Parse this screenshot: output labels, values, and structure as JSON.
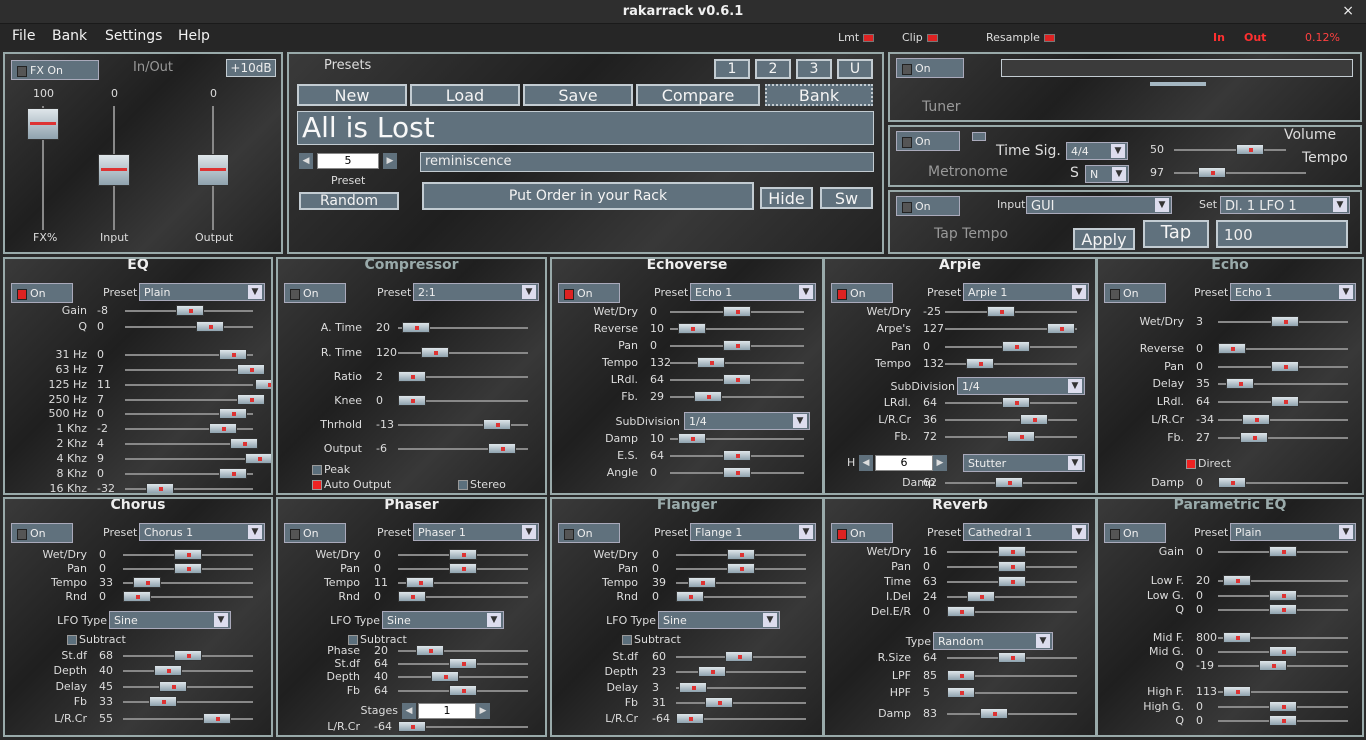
{
  "title": "rakarrack   v0.6.1",
  "close": "×",
  "menu": [
    "File",
    "Bank",
    "Settings",
    "Help"
  ],
  "indicators": {
    "lmt": "Lmt",
    "clip": "Clip",
    "resample": "Resample",
    "in": "In",
    "out": "Out",
    "cpu": "0.12%"
  },
  "io": {
    "fx_on": "FX On",
    "title": "In/Out",
    "gain_btn": "+10dB",
    "fx": {
      "label": "FX%",
      "value": "100"
    },
    "input": {
      "label": "Input",
      "value": "0"
    },
    "output": {
      "label": "Output",
      "value": "0"
    }
  },
  "presets": {
    "title": "Presets",
    "n1": "1",
    "n2": "2",
    "n3": "3",
    "u": "U",
    "new": "New",
    "load": "Load",
    "save": "Save",
    "compare": "Compare",
    "bank": "Bank",
    "name": "All is Lost",
    "number": "5",
    "number_label": "Preset",
    "author": "reminiscence",
    "random": "Random",
    "order": "Put Order in your Rack",
    "hide": "Hide",
    "sw": "Sw"
  },
  "tuner": {
    "on": "On",
    "label": "Tuner"
  },
  "metronome": {
    "on": "On",
    "label": "Metronome",
    "timesig_label": "Time Sig.",
    "timesig": "4/4",
    "s_label": "S",
    "s": "N",
    "volume_label": "Volume",
    "volume": "50",
    "tempo_label": "Tempo",
    "tempo": "97"
  },
  "tap": {
    "on": "On",
    "label": "Tap Tempo",
    "input_label": "Input",
    "input": "GUI",
    "set_label": "Set",
    "set": "Dl. 1 LFO 1",
    "apply": "Apply",
    "tap": "Tap",
    "value": "100"
  },
  "eq": {
    "title": "EQ",
    "on": "On",
    "preset_label": "Preset",
    "preset": "Plain",
    "rows": [
      [
        "Gain",
        "-8"
      ],
      [
        "Q",
        "0"
      ],
      [
        "31 Hz",
        "0"
      ],
      [
        "63 Hz",
        "7"
      ],
      [
        "125 Hz",
        "11"
      ],
      [
        "250 Hz",
        "7"
      ],
      [
        "500 Hz",
        "0"
      ],
      [
        "1 Khz",
        "-2"
      ],
      [
        "2 Khz",
        "4"
      ],
      [
        "4 Khz",
        "9"
      ],
      [
        "8 Khz",
        "0"
      ],
      [
        "16 Khz",
        "-32"
      ]
    ]
  },
  "compressor": {
    "title": "Compressor",
    "on": "On",
    "preset_label": "Preset",
    "preset": "2:1",
    "rows": [
      [
        "A. Time",
        "20"
      ],
      [
        "R. Time",
        "120"
      ],
      [
        "Ratio",
        "2"
      ],
      [
        "Knee",
        "0"
      ],
      [
        "Thrhold",
        "-13"
      ],
      [
        "Output",
        "-6"
      ]
    ],
    "peak": "Peak",
    "auto": "Auto Output",
    "stereo": "Stereo"
  },
  "echoverse": {
    "title": "Echoverse",
    "on": "On",
    "preset_label": "Preset",
    "preset": "Echo 1",
    "rows": [
      [
        "Wet/Dry",
        "0"
      ],
      [
        "Reverse",
        "10"
      ],
      [
        "Pan",
        "0"
      ],
      [
        "Tempo",
        "132"
      ],
      [
        "LRdl.",
        "64"
      ],
      [
        "Fb.",
        "29"
      ]
    ],
    "subdiv_label": "SubDivision",
    "subdiv": "1/4",
    "rows2": [
      [
        "Damp",
        "10"
      ],
      [
        "E.S.",
        "64"
      ],
      [
        "Angle",
        "0"
      ]
    ]
  },
  "arpie": {
    "title": "Arpie",
    "on": "On",
    "preset_label": "Preset",
    "preset": "Arpie 1",
    "rows": [
      [
        "Wet/Dry",
        "-25"
      ],
      [
        "Arpe's",
        "127"
      ],
      [
        "Pan",
        "0"
      ],
      [
        "Tempo",
        "132"
      ]
    ],
    "subdiv_label": "SubDivision",
    "subdiv": "1/4",
    "rows2": [
      [
        "LRdl.",
        "64"
      ],
      [
        "L/R.Cr",
        "36"
      ],
      [
        "Fb.",
        "72"
      ]
    ],
    "h_label": "H",
    "h": "6",
    "mode": "Stutter",
    "damp_label": "Damp",
    "damp": "62"
  },
  "echo": {
    "title": "Echo",
    "on": "On",
    "preset_label": "Preset",
    "preset": "Echo 1",
    "rows": [
      [
        "Wet/Dry",
        "3"
      ],
      [
        "Reverse",
        "0"
      ],
      [
        "Pan",
        "0"
      ],
      [
        "Delay",
        "35"
      ],
      [
        "LRdl.",
        "64"
      ],
      [
        "L/R.Cr",
        "-34"
      ],
      [
        "Fb.",
        "27"
      ]
    ],
    "direct": "Direct",
    "damp_label": "Damp",
    "damp": "0"
  },
  "chorus": {
    "title": "Chorus",
    "on": "On",
    "preset_label": "Preset",
    "preset": "Chorus 1",
    "rows": [
      [
        "Wet/Dry",
        "0"
      ],
      [
        "Pan",
        "0"
      ],
      [
        "Tempo",
        "33"
      ],
      [
        "Rnd",
        "0"
      ]
    ],
    "lfo_label": "LFO Type",
    "lfo": "Sine",
    "subtract": "Subtract",
    "rows2": [
      [
        "St.df",
        "68"
      ],
      [
        "Depth",
        "40"
      ],
      [
        "Delay",
        "45"
      ],
      [
        "Fb",
        "33"
      ],
      [
        "L/R.Cr",
        "55"
      ]
    ]
  },
  "phaser": {
    "title": "Phaser",
    "on": "On",
    "preset_label": "Preset",
    "preset": "Phaser 1",
    "rows": [
      [
        "Wet/Dry",
        "0"
      ],
      [
        "Pan",
        "0"
      ],
      [
        "Tempo",
        "11"
      ],
      [
        "Rnd",
        "0"
      ]
    ],
    "lfo_label": "LFO Type",
    "lfo": "Sine",
    "subtract": "Subtract",
    "rows2": [
      [
        "Phase",
        "20"
      ],
      [
        "St.df",
        "64"
      ],
      [
        "Depth",
        "40"
      ],
      [
        "Fb",
        "64"
      ]
    ],
    "stages_label": "Stages",
    "stages": "1",
    "lrcr_label": "L/R.Cr",
    "lrcr": "-64"
  },
  "flanger": {
    "title": "Flanger",
    "on": "On",
    "preset_label": "Preset",
    "preset": "Flange 1",
    "rows": [
      [
        "Wet/Dry",
        "0"
      ],
      [
        "Pan",
        "0"
      ],
      [
        "Tempo",
        "39"
      ],
      [
        "Rnd",
        "0"
      ]
    ],
    "lfo_label": "LFO Type",
    "lfo": "Sine",
    "subtract": "Subtract",
    "rows2": [
      [
        "St.df",
        "60"
      ],
      [
        "Depth",
        "23"
      ],
      [
        "Delay",
        "3"
      ],
      [
        "Fb",
        "31"
      ],
      [
        "L/R.Cr",
        "-64"
      ]
    ]
  },
  "reverb": {
    "title": "Reverb",
    "on": "On",
    "preset_label": "Preset",
    "preset": "Cathedral 1",
    "rows": [
      [
        "Wet/Dry",
        "16"
      ],
      [
        "Pan",
        "0"
      ],
      [
        "Time",
        "63"
      ],
      [
        "I.Del",
        "24"
      ],
      [
        "Del.E/R",
        "0"
      ]
    ],
    "type_label": "Type",
    "type": "Random",
    "rows2": [
      [
        "R.Size",
        "64"
      ],
      [
        "LPF",
        "85"
      ],
      [
        "HPF",
        "5"
      ],
      [
        "Damp",
        "83"
      ]
    ]
  },
  "peq": {
    "title": "Parametric EQ",
    "on": "On",
    "preset_label": "Preset",
    "preset": "Plain",
    "rows": [
      [
        "Gain",
        "0"
      ],
      [
        "Low F.",
        "20"
      ],
      [
        "Low G.",
        "0"
      ],
      [
        "Q",
        "0"
      ],
      [
        "Mid F.",
        "800"
      ],
      [
        "Mid G.",
        "0"
      ],
      [
        "Q",
        "-19"
      ],
      [
        "High F.",
        "113"
      ],
      [
        "High G.",
        "0"
      ],
      [
        "Q",
        "0"
      ]
    ]
  }
}
